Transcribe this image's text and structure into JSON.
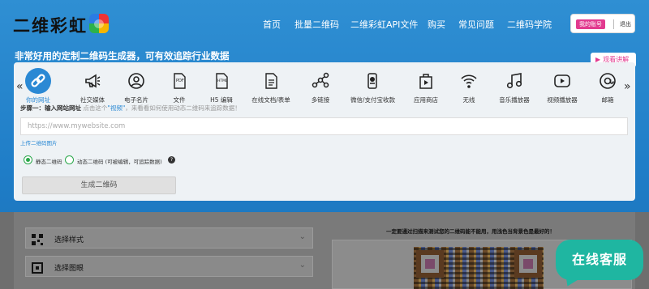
{
  "header": {
    "logo_text": "二维彩虹",
    "nav": [
      "首页",
      "批量二维码",
      "二维彩虹API文件",
      "购买",
      "常见问题",
      "二维码学院"
    ],
    "account_label": "我的账号",
    "logout_label": "退出"
  },
  "tagline": "非常好用的定制二维码生成器，可有效追踪行业数据",
  "watch_label": "观看讲解",
  "tabs": [
    {
      "label": "你的网址",
      "icon": "link-icon",
      "active": true
    },
    {
      "label": "社交媒体",
      "icon": "megaphone-icon"
    },
    {
      "label": "电子名片",
      "icon": "user-card-icon"
    },
    {
      "label": "文件",
      "icon": "pdf-icon"
    },
    {
      "label": "H5 编辑",
      "icon": "html-icon"
    },
    {
      "label": "在线文档/表单",
      "icon": "document-icon"
    },
    {
      "label": "多链接",
      "icon": "multi-link-icon"
    },
    {
      "label": "微信/支付宝收款",
      "icon": "payment-icon"
    },
    {
      "label": "应用商店",
      "icon": "app-store-icon"
    },
    {
      "label": "无线",
      "icon": "wifi-icon"
    },
    {
      "label": "音乐播放器",
      "icon": "music-icon"
    },
    {
      "label": "视频播放器",
      "icon": "video-icon"
    },
    {
      "label": "邮箱",
      "icon": "email-icon"
    }
  ],
  "step": {
    "title": "步骤一：输入网站网址",
    "hint_prefix": "点击这个",
    "hint_link": "\"视频\"",
    "hint_suffix": "，来看看如何使用动态二维码来追踪数据！"
  },
  "url_input": {
    "placeholder": "https://www.mywebsite.com",
    "value": ""
  },
  "upload_label": "上传二维码图片",
  "radios": {
    "static_label": "静态二维码",
    "dynamic_label": "动态二维码 (可被编辑，可追踪数据)",
    "selected": "static"
  },
  "generate_label": "生成二维码",
  "lower": {
    "style_label": "选择样式",
    "eye_label": "选择图眼",
    "notice": "一定要通过扫描来测试您的二维码能不能用，用浅色当背景色是最好的！"
  },
  "chat_label": "在线客服",
  "colors": {
    "accent": "#2b89d4",
    "brand_pink": "#e23a8f",
    "chat": "#1fb6a1"
  }
}
